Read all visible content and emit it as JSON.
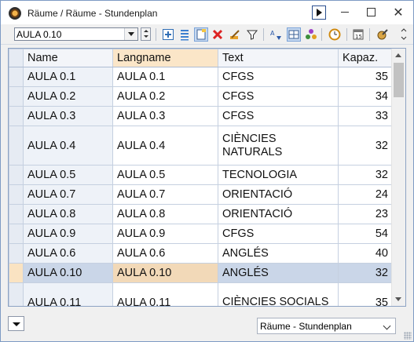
{
  "window": {
    "title": "Räume / Räume - Stundenplan"
  },
  "toolbar": {
    "record_selector_value": "AULA 0.10",
    "icons": [
      "new-record-icon",
      "list-view-icon",
      "form-view-icon",
      "delete-icon",
      "edit-pencil-icon",
      "filter-icon",
      "sort-icon",
      "grid-settings-icon",
      "link-icon",
      "clock-icon",
      "calendar-icon",
      "settings-brush-icon"
    ]
  },
  "grid": {
    "columns": [
      "Name",
      "Langname",
      "Text",
      "Kapaz."
    ],
    "rows": [
      {
        "name": "AULA 0.1",
        "langname": "AULA 0.1",
        "text": "CFGS",
        "capacity": "35",
        "tall": false,
        "selected": false
      },
      {
        "name": "AULA 0.2",
        "langname": "AULA 0.2",
        "text": "CFGS",
        "capacity": "34",
        "tall": false,
        "selected": false
      },
      {
        "name": "AULA 0.3",
        "langname": "AULA 0.3",
        "text": "CFGS",
        "capacity": "33",
        "tall": false,
        "selected": false
      },
      {
        "name": "AULA 0.4",
        "langname": "AULA 0.4",
        "text": "CIÈNCIES NATURALS",
        "capacity": "32",
        "tall": true,
        "selected": false
      },
      {
        "name": "AULA 0.5",
        "langname": "AULA 0.5",
        "text": "TECNOLOGIA",
        "capacity": "32",
        "tall": false,
        "selected": false
      },
      {
        "name": "AULA 0.7",
        "langname": "AULA 0.7",
        "text": "ORIENTACIÓ",
        "capacity": "24",
        "tall": false,
        "selected": false
      },
      {
        "name": "AULA 0.8",
        "langname": "AULA 0.8",
        "text": "ORIENTACIÓ",
        "capacity": "23",
        "tall": false,
        "selected": false
      },
      {
        "name": "AULA 0.9",
        "langname": "AULA 0.9",
        "text": "CFGS",
        "capacity": "54",
        "tall": false,
        "selected": false
      },
      {
        "name": "AULA 0.6",
        "langname": "AULA 0.6",
        "text": "ANGLÉS",
        "capacity": "40",
        "tall": false,
        "selected": false
      },
      {
        "name": "AULA 0.10",
        "langname": "AULA 0.10",
        "text": "ANGLÉS",
        "capacity": "32",
        "tall": false,
        "selected": true
      },
      {
        "name": "AULA 0.11",
        "langname": "AULA 0.11",
        "text": "CIÈNCIES SOCIALS",
        "capacity": "35",
        "tall": true,
        "selected": false
      }
    ]
  },
  "footer": {
    "view_select_value": "Räume - Stundenplan"
  },
  "colors": {
    "selected_row": "#cad6e8",
    "selected_row_header": "#fae3c2",
    "langname_header": "#fbe6c8",
    "window_border": "#7d9ac4"
  }
}
